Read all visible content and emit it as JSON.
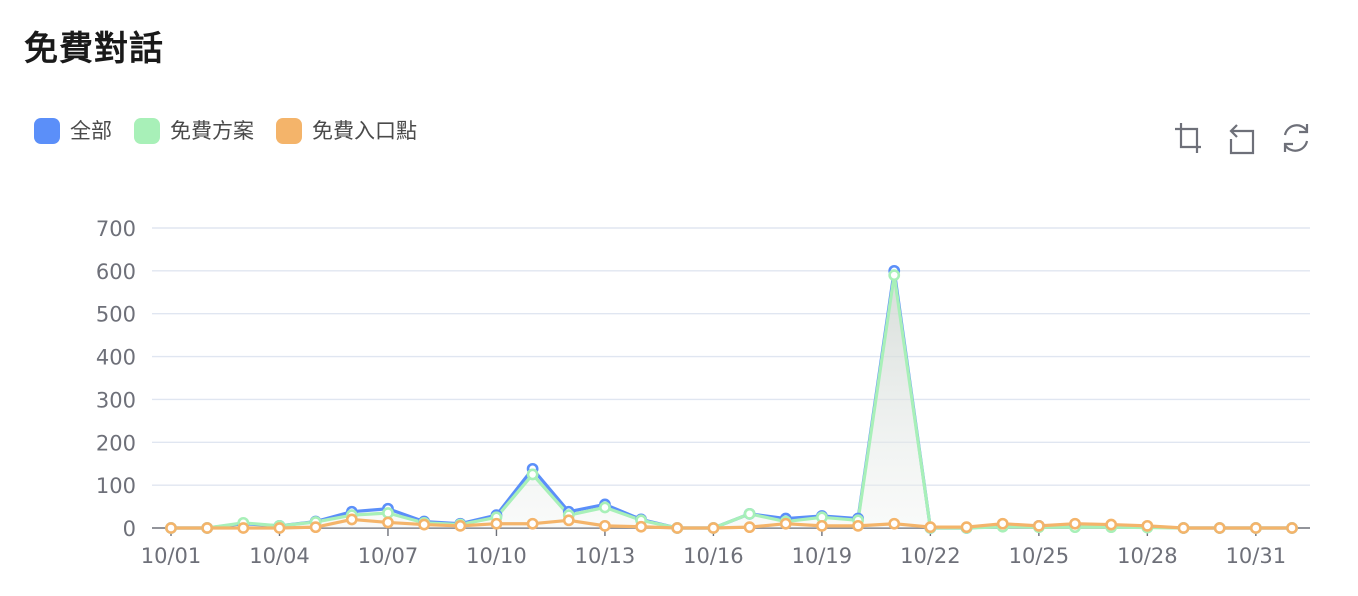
{
  "page": {
    "title": "免費對話"
  },
  "legend": [
    {
      "name": "全部",
      "color": "#5b8ff9"
    },
    {
      "name": "免費方案",
      "color": "#a8f0b8"
    },
    {
      "name": "免費入口點",
      "color": "#f4b46a"
    }
  ],
  "toolbox": [
    {
      "icon": "zoom-select-icon"
    },
    {
      "icon": "zoom-reset-icon"
    },
    {
      "icon": "restore-icon"
    }
  ],
  "chart_data": {
    "type": "line",
    "ylim": [
      0,
      700
    ],
    "y_ticks": [
      0,
      100,
      200,
      300,
      400,
      500,
      600,
      700
    ],
    "grid": true,
    "legend_position": "top-left",
    "x": [
      "10/01",
      "10/02",
      "10/03",
      "10/04",
      "10/05",
      "10/06",
      "10/07",
      "10/08",
      "10/09",
      "10/10",
      "10/11",
      "10/12",
      "10/13",
      "10/14",
      "10/15",
      "10/16",
      "10/17",
      "10/18",
      "10/19",
      "10/20",
      "10/21",
      "10/22",
      "10/23",
      "10/24",
      "10/25",
      "10/26",
      "10/27",
      "10/28",
      "10/29",
      "10/30",
      "10/31",
      "11/01"
    ],
    "x_tick_labels": [
      "10/01",
      "10/04",
      "10/07",
      "10/10",
      "10/13",
      "10/16",
      "10/19",
      "10/22",
      "10/25",
      "10/28",
      "10/31"
    ],
    "series": [
      {
        "name": "全部",
        "color": "#5b8ff9",
        "values": [
          0,
          0,
          10,
          5,
          15,
          38,
          45,
          15,
          10,
          30,
          138,
          38,
          55,
          20,
          0,
          0,
          33,
          22,
          28,
          22,
          600,
          0,
          0,
          5,
          5,
          5,
          5,
          3,
          0,
          0,
          0,
          0
        ]
      },
      {
        "name": "免費方案",
        "color": "#a8f0b8",
        "values": [
          0,
          0,
          12,
          5,
          14,
          30,
          35,
          12,
          8,
          25,
          125,
          30,
          48,
          18,
          0,
          0,
          33,
          15,
          25,
          18,
          590,
          0,
          0,
          3,
          2,
          2,
          2,
          1,
          0,
          0,
          0,
          0
        ]
      },
      {
        "name": "免費入口點",
        "color": "#f4b46a",
        "values": [
          0,
          0,
          0,
          0,
          2,
          20,
          13,
          8,
          5,
          10,
          10,
          18,
          5,
          3,
          0,
          0,
          2,
          10,
          5,
          5,
          10,
          2,
          2,
          10,
          5,
          10,
          8,
          5,
          0,
          0,
          0,
          0
        ]
      }
    ]
  }
}
